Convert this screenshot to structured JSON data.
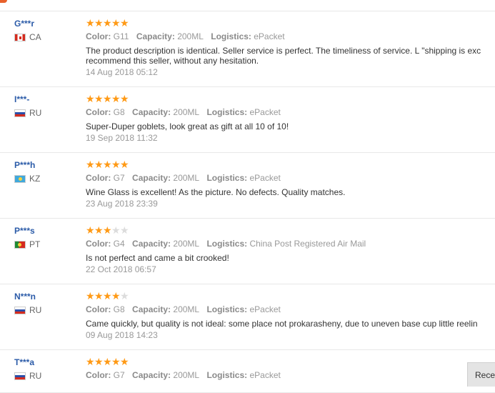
{
  "reviews": [
    {
      "user": "G***r",
      "country": "CA",
      "flag": "flag-ca",
      "stars": 5,
      "color_label": "Color:",
      "color": "G11",
      "capacity_label": "Capacity:",
      "capacity": "200ML",
      "logistics_label": "Logistics:",
      "logistics": "ePacket",
      "text_lines": [
        "The product description is identical. Seller service is perfect. The timeliness of service. L \"shipping is exc",
        "recommend this seller, without any hesitation."
      ],
      "date": "14 Aug 2018 05:12"
    },
    {
      "user": "I***-",
      "country": "RU",
      "flag": "flag-ru",
      "stars": 5,
      "color_label": "Color:",
      "color": "G8",
      "capacity_label": "Capacity:",
      "capacity": "200ML",
      "logistics_label": "Logistics:",
      "logistics": "ePacket",
      "text_lines": [
        "Super-Duper goblets, look great as gift at all 10 of 10!"
      ],
      "date": "19 Sep 2018 11:32"
    },
    {
      "user": "P***h",
      "country": "KZ",
      "flag": "flag-kz",
      "stars": 5,
      "color_label": "Color:",
      "color": "G7",
      "capacity_label": "Capacity:",
      "capacity": "200ML",
      "logistics_label": "Logistics:",
      "logistics": "ePacket",
      "text_lines": [
        "Wine Glass is excellent! As the picture. No defects. Quality matches."
      ],
      "date": "23 Aug 2018 23:39"
    },
    {
      "user": "P***s",
      "country": "PT",
      "flag": "flag-pt",
      "stars": 3,
      "color_label": "Color:",
      "color": "G4",
      "capacity_label": "Capacity:",
      "capacity": "200ML",
      "logistics_label": "Logistics:",
      "logistics": "China Post Registered Air Mail",
      "text_lines": [
        "Is not perfect and came a bit crooked!"
      ],
      "date": "22 Oct 2018 06:57"
    },
    {
      "user": "N***n",
      "country": "RU",
      "flag": "flag-ru",
      "stars": 4,
      "color_label": "Color:",
      "color": "G8",
      "capacity_label": "Capacity:",
      "capacity": "200ML",
      "logistics_label": "Logistics:",
      "logistics": "ePacket",
      "text_lines": [
        "Came quickly, but quality is not ideal: some place not prokarasheny, due to uneven base cup little reelin"
      ],
      "date": "09 Aug 2018 14:23"
    },
    {
      "user": "T***a",
      "country": "RU",
      "flag": "flag-ru",
      "stars": 5,
      "color_label": "Color:",
      "color": "G7",
      "capacity_label": "Capacity:",
      "capacity": "200ML",
      "logistics_label": "Logistics:",
      "logistics": "ePacket",
      "text_lines": [],
      "date": ""
    }
  ],
  "recent_tab": {
    "label": "Rece"
  },
  "colors": {
    "star": "#ff9a16",
    "username": "#2b5ba8",
    "accent": "#e8612c"
  },
  "icons": {
    "star": "star-icon",
    "flag": "country-flag-icon"
  }
}
